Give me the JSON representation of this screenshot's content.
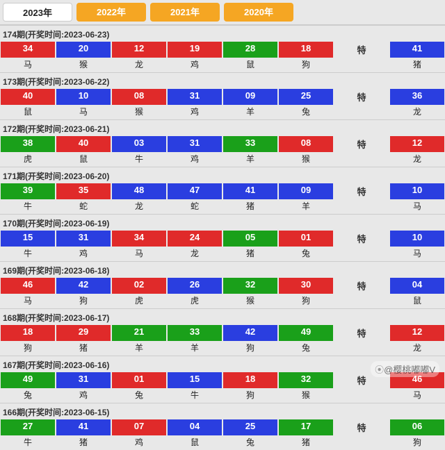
{
  "tabs": [
    {
      "label": "2023年",
      "active": true
    },
    {
      "label": "2022年",
      "active": false
    },
    {
      "label": "2021年",
      "active": false
    },
    {
      "label": "2020年",
      "active": false
    }
  ],
  "te_label": "特",
  "watermark": "@樱桃嘟嘟V",
  "draws": [
    {
      "period": "174",
      "date": "2023-06-23",
      "balls": [
        {
          "n": "34",
          "c": "red",
          "z": "马"
        },
        {
          "n": "20",
          "c": "blue",
          "z": "猴"
        },
        {
          "n": "12",
          "c": "red",
          "z": "龙"
        },
        {
          "n": "19",
          "c": "red",
          "z": "鸡"
        },
        {
          "n": "28",
          "c": "green",
          "z": "鼠"
        },
        {
          "n": "18",
          "c": "red",
          "z": "狗"
        },
        {
          "n": "41",
          "c": "blue",
          "z": "猪"
        }
      ]
    },
    {
      "period": "173",
      "date": "2023-06-22",
      "balls": [
        {
          "n": "40",
          "c": "red",
          "z": "鼠"
        },
        {
          "n": "10",
          "c": "blue",
          "z": "马"
        },
        {
          "n": "08",
          "c": "red",
          "z": "猴"
        },
        {
          "n": "31",
          "c": "blue",
          "z": "鸡"
        },
        {
          "n": "09",
          "c": "blue",
          "z": "羊"
        },
        {
          "n": "25",
          "c": "blue",
          "z": "兔"
        },
        {
          "n": "36",
          "c": "blue",
          "z": "龙"
        }
      ]
    },
    {
      "period": "172",
      "date": "2023-06-21",
      "balls": [
        {
          "n": "38",
          "c": "green",
          "z": "虎"
        },
        {
          "n": "40",
          "c": "red",
          "z": "鼠"
        },
        {
          "n": "03",
          "c": "blue",
          "z": "牛"
        },
        {
          "n": "31",
          "c": "blue",
          "z": "鸡"
        },
        {
          "n": "33",
          "c": "green",
          "z": "羊"
        },
        {
          "n": "08",
          "c": "red",
          "z": "猴"
        },
        {
          "n": "12",
          "c": "red",
          "z": "龙"
        }
      ]
    },
    {
      "period": "171",
      "date": "2023-06-20",
      "balls": [
        {
          "n": "39",
          "c": "green",
          "z": "牛"
        },
        {
          "n": "35",
          "c": "red",
          "z": "蛇"
        },
        {
          "n": "48",
          "c": "blue",
          "z": "龙"
        },
        {
          "n": "47",
          "c": "blue",
          "z": "蛇"
        },
        {
          "n": "41",
          "c": "blue",
          "z": "猪"
        },
        {
          "n": "09",
          "c": "blue",
          "z": "羊"
        },
        {
          "n": "10",
          "c": "blue",
          "z": "马"
        }
      ]
    },
    {
      "period": "170",
      "date": "2023-06-19",
      "balls": [
        {
          "n": "15",
          "c": "blue",
          "z": "牛"
        },
        {
          "n": "31",
          "c": "blue",
          "z": "鸡"
        },
        {
          "n": "34",
          "c": "red",
          "z": "马"
        },
        {
          "n": "24",
          "c": "red",
          "z": "龙"
        },
        {
          "n": "05",
          "c": "green",
          "z": "猪"
        },
        {
          "n": "01",
          "c": "red",
          "z": "兔"
        },
        {
          "n": "10",
          "c": "blue",
          "z": "马"
        }
      ]
    },
    {
      "period": "169",
      "date": "2023-06-18",
      "balls": [
        {
          "n": "46",
          "c": "red",
          "z": "马"
        },
        {
          "n": "42",
          "c": "blue",
          "z": "狗"
        },
        {
          "n": "02",
          "c": "red",
          "z": "虎"
        },
        {
          "n": "26",
          "c": "blue",
          "z": "虎"
        },
        {
          "n": "32",
          "c": "green",
          "z": "猴"
        },
        {
          "n": "30",
          "c": "red",
          "z": "狗"
        },
        {
          "n": "04",
          "c": "blue",
          "z": "鼠"
        }
      ]
    },
    {
      "period": "168",
      "date": "2023-06-17",
      "balls": [
        {
          "n": "18",
          "c": "red",
          "z": "狗"
        },
        {
          "n": "29",
          "c": "red",
          "z": "猪"
        },
        {
          "n": "21",
          "c": "green",
          "z": "羊"
        },
        {
          "n": "33",
          "c": "green",
          "z": "羊"
        },
        {
          "n": "42",
          "c": "blue",
          "z": "狗"
        },
        {
          "n": "49",
          "c": "green",
          "z": "兔"
        },
        {
          "n": "12",
          "c": "red",
          "z": "龙"
        }
      ]
    },
    {
      "period": "167",
      "date": "2023-06-16",
      "balls": [
        {
          "n": "49",
          "c": "green",
          "z": "兔"
        },
        {
          "n": "31",
          "c": "blue",
          "z": "鸡"
        },
        {
          "n": "01",
          "c": "red",
          "z": "兔"
        },
        {
          "n": "15",
          "c": "blue",
          "z": "牛"
        },
        {
          "n": "18",
          "c": "red",
          "z": "狗"
        },
        {
          "n": "32",
          "c": "green",
          "z": "猴"
        },
        {
          "n": "46",
          "c": "red",
          "z": "马"
        }
      ]
    },
    {
      "period": "166",
      "date": "2023-06-15",
      "balls": [
        {
          "n": "27",
          "c": "green",
          "z": "牛"
        },
        {
          "n": "41",
          "c": "blue",
          "z": "猪"
        },
        {
          "n": "07",
          "c": "red",
          "z": "鸡"
        },
        {
          "n": "04",
          "c": "blue",
          "z": "鼠"
        },
        {
          "n": "25",
          "c": "blue",
          "z": "兔"
        },
        {
          "n": "17",
          "c": "green",
          "z": "猪"
        },
        {
          "n": "06",
          "c": "green",
          "z": "狗"
        }
      ]
    }
  ]
}
